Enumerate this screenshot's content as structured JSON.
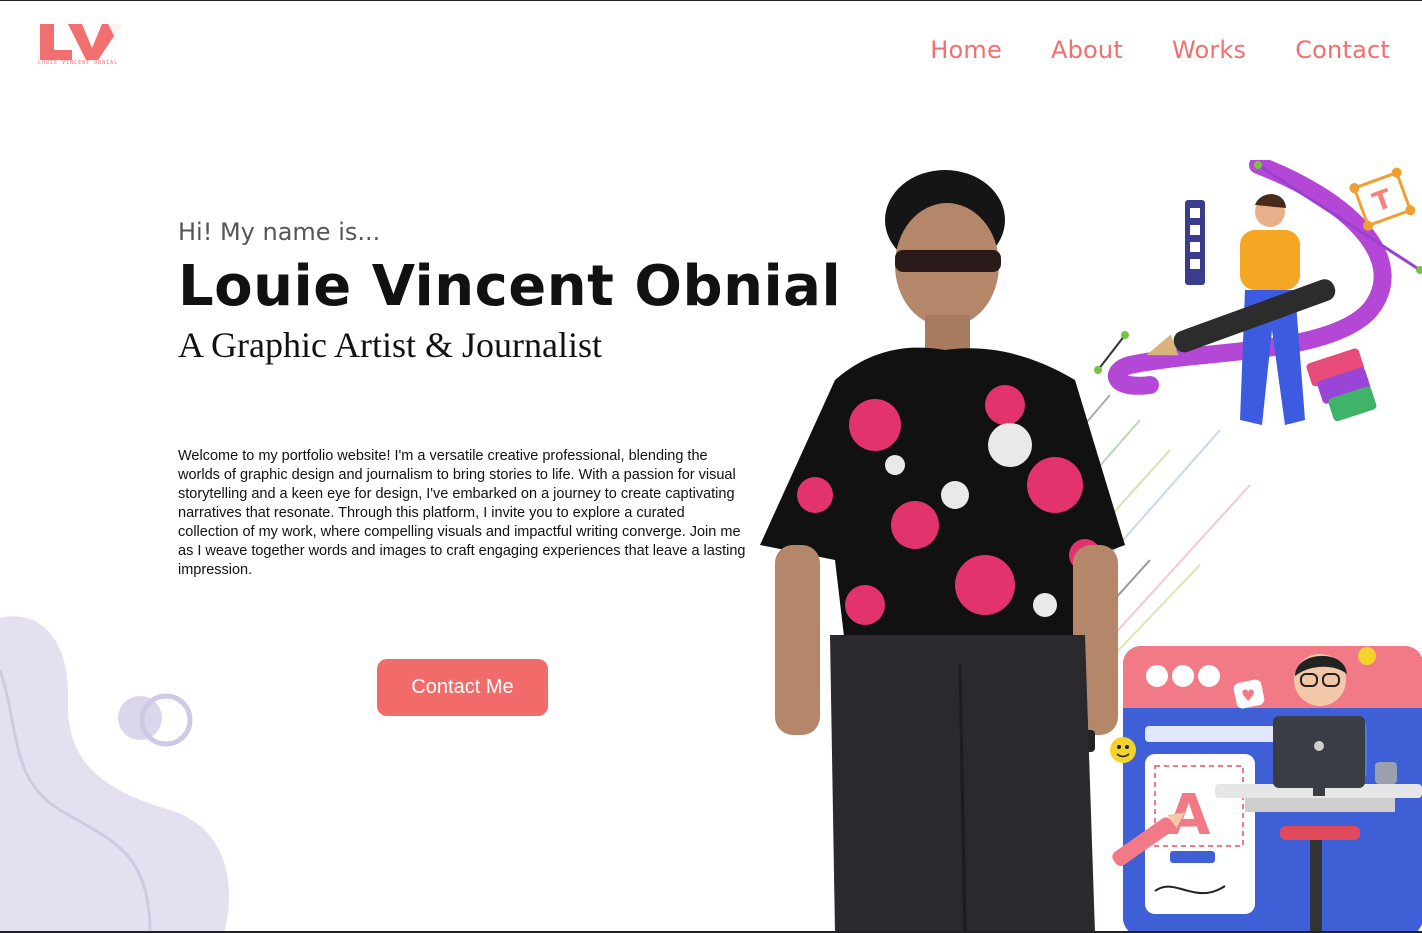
{
  "brand": {
    "logo_text": "LV",
    "logo_tagline": "LOUIE VINCENT OBNIAL",
    "accent_color": "#f26f6f"
  },
  "nav": {
    "items": [
      {
        "label": "Home"
      },
      {
        "label": "About"
      },
      {
        "label": "Works"
      },
      {
        "label": "Contact"
      }
    ]
  },
  "hero": {
    "greeting": "Hi! My name is...",
    "name": "Louie Vincent Obnial",
    "role": "A Graphic Artist & Journalist",
    "intro": "Welcome to my portfolio website! I'm a versatile creative professional, blending the worlds of graphic design and journalism to bring stories to life. With a passion for visual storytelling and a keen eye for design, I've embarked on a journey to create captivating narratives that resonate. Through this platform, I invite you to explore a curated collection of my work, where compelling visuals and impactful writing converge. Join me as I weave together words and images to craft engaging experiences that leave a lasting impression.",
    "cta_label": "Contact Me"
  },
  "illustrations": {
    "workspace_letter": "A"
  }
}
